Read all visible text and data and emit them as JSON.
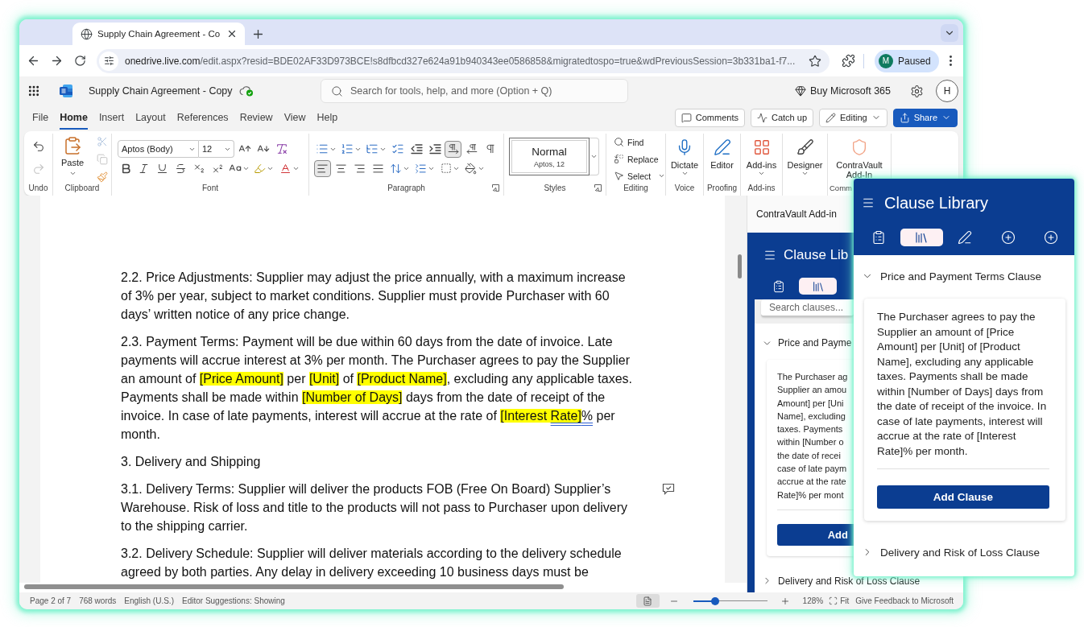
{
  "browser": {
    "tabs": [
      {
        "title": "Supply Chain Agreement - Co",
        "selected": true
      }
    ],
    "url": {
      "host": "onedrive.live.com",
      "path": "/edit.aspx?resid=BDE02AF33D973BCE!s8dfbcd327e624a91b940343ee0586858&migratedtospo=true&wdPreviousSession=3b331ba1-f7..."
    },
    "profile": {
      "initial": "M",
      "status": "Paused"
    }
  },
  "app_bar": {
    "title": "Supply Chain Agreement - Copy",
    "search_placeholder": "Search for tools, help, and more (Option + Q)",
    "buy_label": "Buy Microsoft 365",
    "account_initial": "H"
  },
  "menu_tabs": [
    {
      "label": "File",
      "selected": false
    },
    {
      "label": "Home",
      "selected": true
    },
    {
      "label": "Insert",
      "selected": false
    },
    {
      "label": "Layout",
      "selected": false
    },
    {
      "label": "References",
      "selected": false
    },
    {
      "label": "Review",
      "selected": false
    },
    {
      "label": "View",
      "selected": false
    },
    {
      "label": "Help",
      "selected": false
    }
  ],
  "actions": [
    {
      "kind": "comments",
      "label": "Comments"
    },
    {
      "kind": "catch_up",
      "label": "Catch up"
    },
    {
      "kind": "mode",
      "label": "Editing"
    },
    {
      "kind": "share",
      "label": "Share"
    }
  ],
  "ribbon": [
    {
      "kind": "undo",
      "label": "Undo",
      "redo_disabled": true
    },
    {
      "kind": "clipboard",
      "label": "Clipboard",
      "paste_label": "Paste",
      "cut_disabled": true,
      "copy_disabled": true
    },
    {
      "kind": "font",
      "label": "Font",
      "font_name": "Aptos (Body)",
      "font_size": "12"
    },
    {
      "kind": "paragraph",
      "label": "Paragraph",
      "launcher": true,
      "direction": [
        {
          "selected": true
        },
        {
          "selected": false
        }
      ],
      "alignment": [
        {
          "selected": true
        },
        {
          "selected": false
        },
        {
          "selected": false
        },
        {
          "selected": false
        }
      ]
    },
    {
      "kind": "styles",
      "label": "Styles",
      "launcher": true,
      "style_name": "Normal",
      "style_font": "Aptos, 12"
    },
    {
      "kind": "editing",
      "label": "Editing",
      "commands": [
        {
          "label": "Find",
          "has_menu": false
        },
        {
          "label": "Replace",
          "has_menu": false
        },
        {
          "label": "Select",
          "has_menu": true
        }
      ]
    },
    {
      "kind": "voice",
      "label": "Voice",
      "button": "Dictate",
      "has_menu": true
    },
    {
      "kind": "proofing",
      "label": "Proofing",
      "button": "Editor",
      "has_menu": false
    },
    {
      "kind": "addins",
      "label": "Add-ins",
      "button": "Add-ins",
      "has_menu": true
    },
    {
      "kind": "designer",
      "button": "Designer",
      "has_menu": true
    },
    {
      "kind": "contravault",
      "label": "Comm",
      "button": "ContraVault Add-In",
      "has_menu": false
    }
  ],
  "document": {
    "paragraphs": [
      {
        "comment": false,
        "segments": [
          {
            "kind": "text",
            "text": "2.2. Price Adjustments: Supplier may adjust the price annually, with a maximum increase of 3% per year, subject to market conditions. Supplier must provide Purchaser with 60 days’ written notice of any price change."
          }
        ]
      },
      {
        "comment": false,
        "segments": [
          {
            "kind": "text",
            "text": "2.3. Payment Terms: Payment will be due within 60 days from the date of invoice. Late payments will accrue interest at 3% per month. The Purchaser agrees to pay the Supplier an amount of "
          },
          {
            "kind": "highlight",
            "text": "[Price Amount]"
          },
          {
            "kind": "text",
            "text": " per "
          },
          {
            "kind": "highlight",
            "text": "[Unit]"
          },
          {
            "kind": "text",
            "text": " of "
          },
          {
            "kind": "highlight",
            "text": "[Product Name]"
          },
          {
            "kind": "text",
            "text": ", excluding any applicable taxes. Payments shall be made within "
          },
          {
            "kind": "highlight",
            "text": "[Number of Days]"
          },
          {
            "kind": "text",
            "text": " days from the date of receipt of the invoice. In case of late payments, interest will accrue at the rate of "
          },
          {
            "kind": "highlight",
            "text": "[Interest "
          },
          {
            "kind": "highlight_suggestion",
            "text": "Rate]"
          },
          {
            "kind": "suggestion",
            "text": "%"
          },
          {
            "kind": "text",
            "text": " per month."
          }
        ]
      },
      {
        "comment": false,
        "segments": [
          {
            "kind": "text",
            "text": "3. Delivery and Shipping"
          }
        ]
      },
      {
        "comment": true,
        "segments": [
          {
            "kind": "text",
            "text": "3.1. Delivery Terms: Supplier will deliver the products FOB (Free On Board) Supplier’s Warehouse. Risk of loss and title to the products will not pass to Purchaser upon delivery to the shipping carrier."
          }
        ]
      },
      {
        "comment": false,
        "segments": [
          {
            "kind": "text",
            "text": "3.2. Delivery Schedule: Supplier will deliver materials according to the delivery schedule agreed by both parties. Any delay in delivery exceeding 10 business days must be"
          }
        ]
      }
    ]
  },
  "task_pane": {
    "title": "ContraVault Add-in",
    "header": "Clause Lib",
    "tabs": [
      {
        "selected": false
      },
      {
        "selected": true
      }
    ],
    "search_placeholder": "Search clauses...",
    "sections": [
      {
        "title": "Price and Payme",
        "expanded": true,
        "body_lines": [
          "The Purchaser ag",
          "Supplier an amou",
          "Amount] per [Uni",
          "Name], excluding",
          "taxes. Payments",
          "within [Number o",
          "the date of recei",
          "case of late paym",
          "accrue at the rate",
          "Rate]% per mont"
        ],
        "button": "Add"
      },
      {
        "title": "Delivery and Risk of Loss Clause",
        "expanded": false
      }
    ]
  },
  "clause_library": {
    "title": "Clause Library",
    "tabs": [
      {
        "selected": false
      },
      {
        "selected": true
      },
      {
        "selected": false
      },
      {
        "selected": false
      },
      {
        "selected": false
      }
    ],
    "sections": [
      {
        "title": "Price and Payment Terms Clause",
        "expanded": true,
        "body": "The Purchaser agrees to pay the Supplier an amount of [Price Amount] per [Unit] of [Product Name], excluding any applicable taxes. Payments shall be made within [Number of Days] days from the date of receipt of the invoice. In case of late payments, interest will accrue at the rate of [Interest Rate]% per month.",
        "button": "Add Clause"
      },
      {
        "title": "Delivery and Risk of Loss Clause",
        "expanded": false
      }
    ]
  },
  "status_bar": {
    "items": [
      "Page 2 of 7",
      "768 words",
      "English (U.S.)",
      "Editor Suggestions: Showing"
    ],
    "views": [
      {
        "selected": true
      }
    ],
    "zoom": {
      "level": 0.3,
      "reading": "128%"
    },
    "fit_label": "Fit",
    "feedback": "Give Feedback to Microsoft"
  }
}
